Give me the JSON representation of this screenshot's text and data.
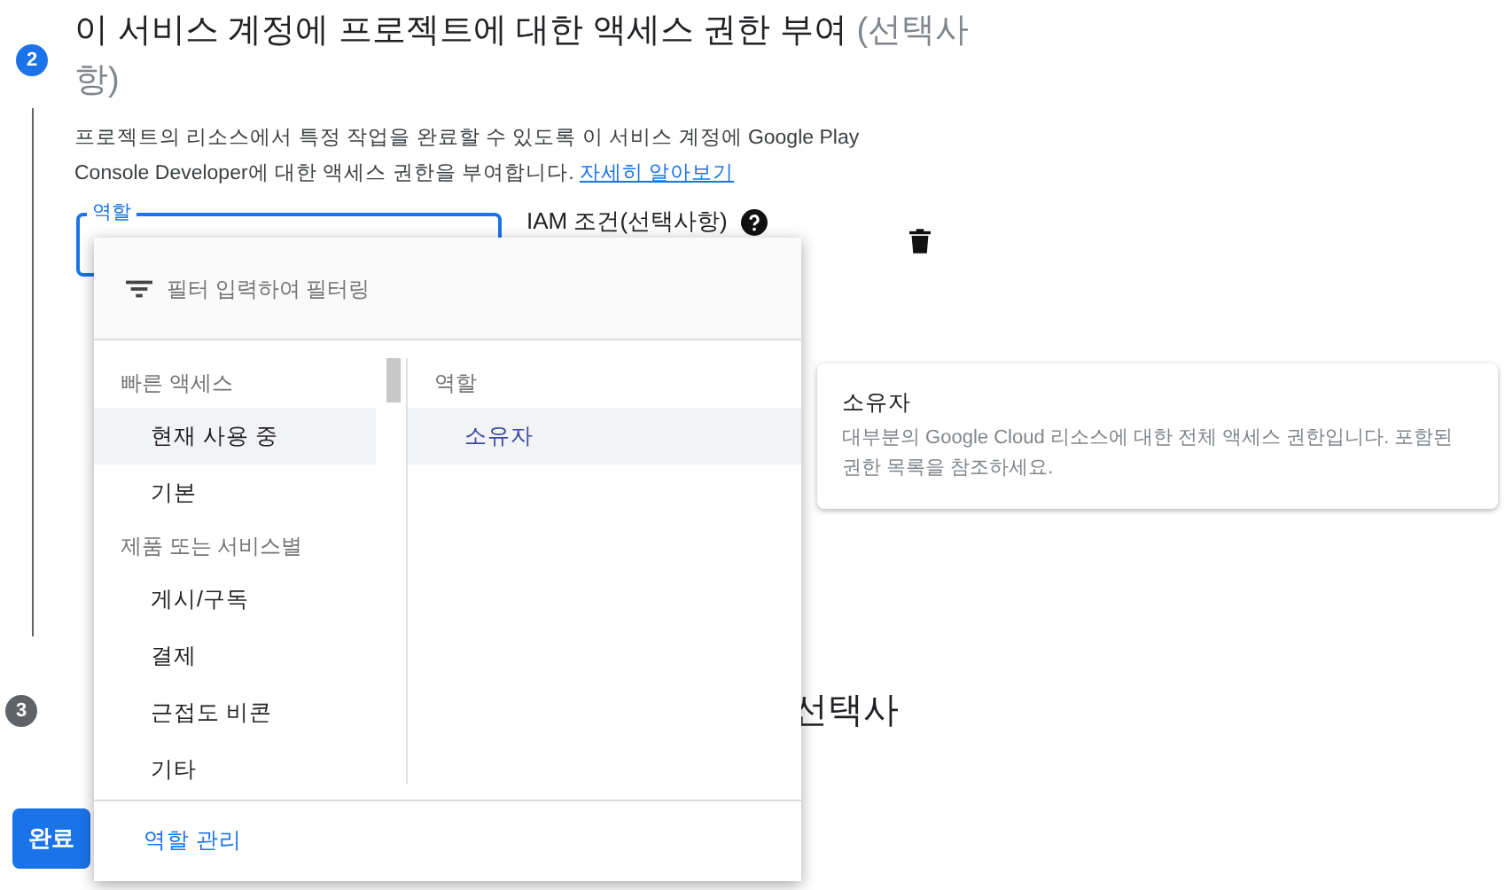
{
  "step2": {
    "number": "2",
    "title": "이 서비스 계정에 프로젝트에 대한 액세스 권한 부여",
    "title_suffix": "(선택사항)",
    "description": "프로젝트의 리소스에서 특정 작업을 완료할 수 있도록 이 서비스 계정에 Google Play Console Developer에 대한 액세스 권한을 부여합니다.",
    "learn_more": "자세히 알아보기",
    "role_field": {
      "label": "역할"
    },
    "iam_condition": "IAM 조건(선택사항)"
  },
  "step3": {
    "number": "3",
    "title_visible": "선택사"
  },
  "done_button": "완료",
  "role_menu": {
    "filter_placeholder": "필터 입력하여 필터링",
    "categories": [
      {
        "kind": "header",
        "label": "빠른 액세스"
      },
      {
        "kind": "item",
        "label": "현재 사용 중",
        "selected": true
      },
      {
        "kind": "item",
        "label": "기본",
        "selected": false
      },
      {
        "kind": "header",
        "label": "제품 또는 서비스별"
      },
      {
        "kind": "item",
        "label": "게시/구독",
        "selected": false
      },
      {
        "kind": "item",
        "label": "결제",
        "selected": false
      },
      {
        "kind": "item",
        "label": "근접도 비콘",
        "selected": false
      },
      {
        "kind": "item",
        "label": "기타",
        "selected": false
      }
    ],
    "roles_header": "역할",
    "roles": [
      {
        "label": "소유자",
        "selected": true
      }
    ],
    "footer_link": "역할 관리"
  },
  "role_info": {
    "title": "소유자",
    "description": "대부분의 Google Cloud 리소스에 대한 전체 액세스 권한입니다. 포함된 권한 목록을 참조하세요."
  }
}
